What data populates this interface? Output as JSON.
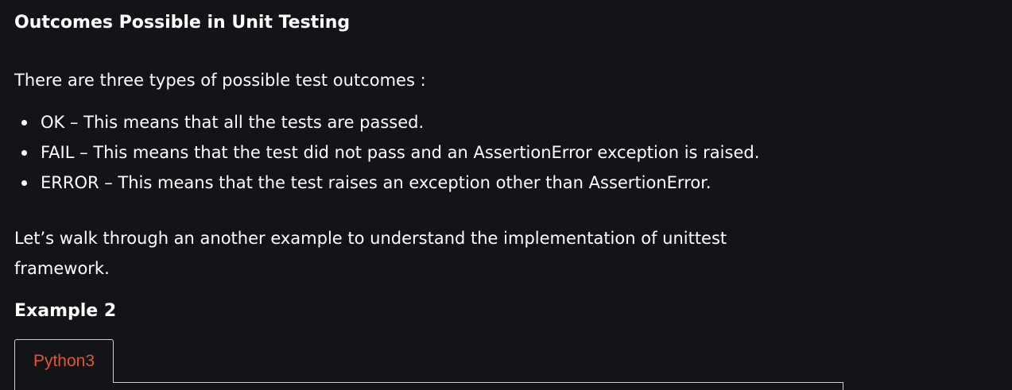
{
  "section_title": "Outcomes Possible in Unit Testing",
  "intro_text": "There are three types of possible test outcomes :",
  "outcomes": [
    "OK – This means that all the tests are passed.",
    "FAIL – This means that the test did not pass and an AssertionError exception is raised.",
    "ERROR – This means that the test raises an exception other than AssertionError."
  ],
  "walkthrough_text": "Let’s walk through an another example to understand the implementation of unittest framework.",
  "example_title": "Example 2",
  "code_tabs": [
    {
      "label": "Python3",
      "active": true,
      "color": "#e2572a"
    }
  ]
}
